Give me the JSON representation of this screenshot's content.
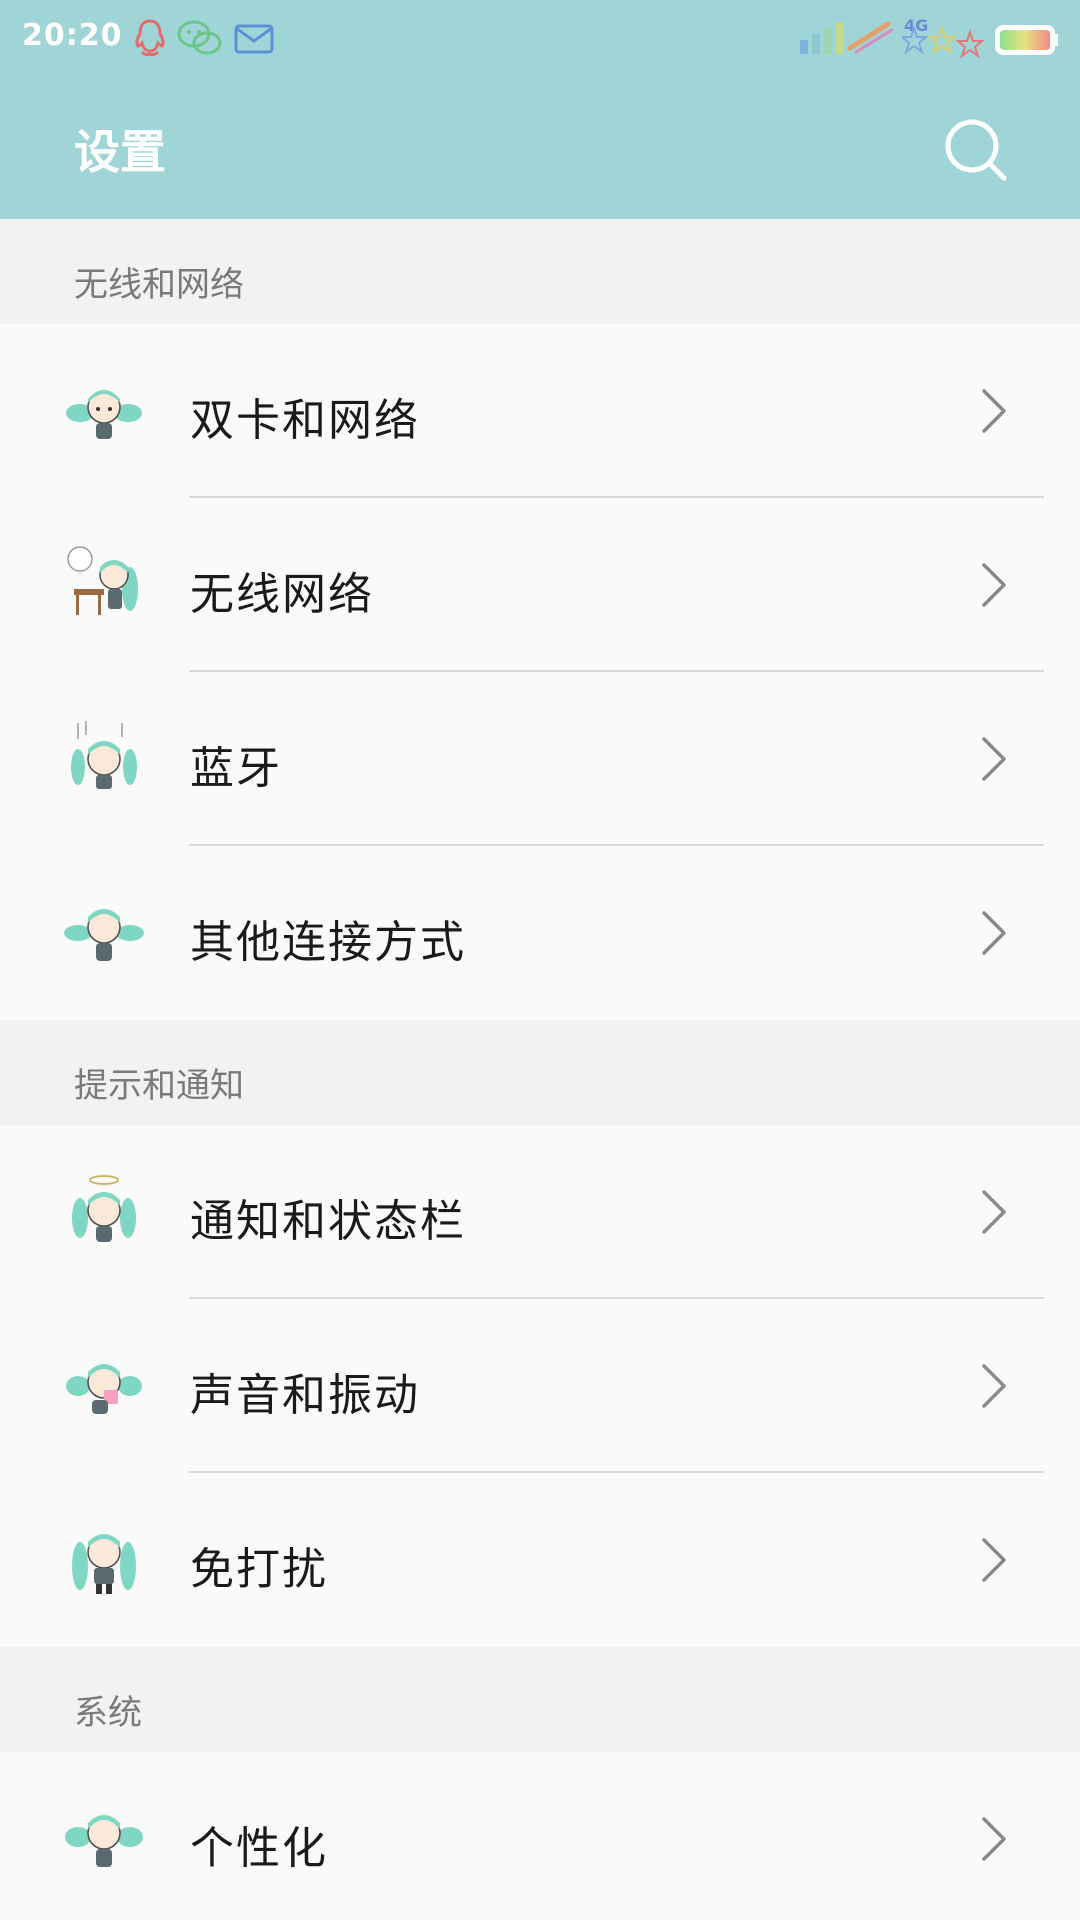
{
  "status_bar": {
    "time": "20:20",
    "network": "4G",
    "icons": [
      "qq-icon",
      "wechat-icon",
      "mail-icon",
      "signal-icon",
      "star-icon",
      "battery-icon"
    ]
  },
  "app_bar": {
    "title": "设置",
    "search_icon": "search-icon"
  },
  "colors": {
    "header_bg": "#a0d5d8",
    "section_bg": "#f2f2f2",
    "row_bg": "#fafafa",
    "accent": "#7fd6c2"
  },
  "sections": [
    {
      "title": "无线和网络",
      "items": [
        {
          "label": "双卡和网络"
        },
        {
          "label": "无线网络"
        },
        {
          "label": "蓝牙"
        },
        {
          "label": "其他连接方式"
        }
      ]
    },
    {
      "title": "提示和通知",
      "items": [
        {
          "label": "通知和状态栏"
        },
        {
          "label": "声音和振动"
        },
        {
          "label": "免打扰"
        }
      ]
    },
    {
      "title": "系统",
      "items": [
        {
          "label": "个性化"
        }
      ]
    }
  ]
}
